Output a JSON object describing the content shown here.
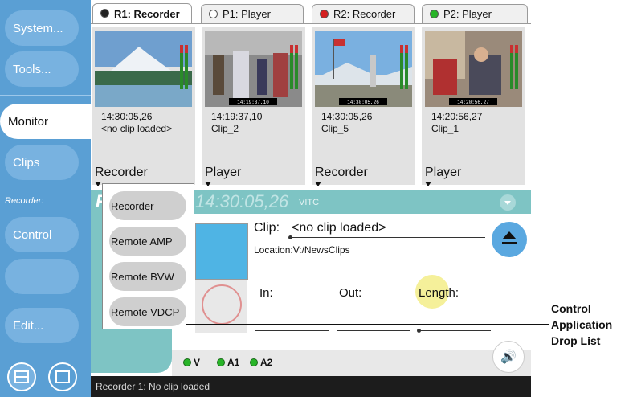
{
  "sidebar": {
    "items": [
      {
        "label": "System..."
      },
      {
        "label": "Tools..."
      },
      {
        "label": "Monitor"
      },
      {
        "label": "Clips"
      },
      {
        "label": "Control"
      },
      {
        "label": ""
      },
      {
        "label": "Edit..."
      }
    ],
    "section_label": "Recorder:",
    "layout_icons": [
      "split-view-icon",
      "single-view-icon"
    ]
  },
  "tabs": [
    {
      "label": "R1: Recorder",
      "led_color": "#222222",
      "active": true
    },
    {
      "label": "P1: Player",
      "led_color": "#ffffff",
      "active": false
    },
    {
      "label": "R2: Recorder",
      "led_color": "#d42020",
      "active": false
    },
    {
      "label": "P2: Player",
      "led_color": "#28b428",
      "active": false
    }
  ],
  "channels": [
    {
      "timecode": "14:30:05,26",
      "clip": "<no clip loaded>",
      "mode": "Recorder",
      "thumb_timecode": ""
    },
    {
      "timecode": "14:19:37,10",
      "clip": "Clip_2",
      "mode": "Player",
      "thumb_timecode": "14:19:37,10"
    },
    {
      "timecode": "14:30:05,26",
      "clip": "Clip_5",
      "mode": "Recorder",
      "thumb_timecode": "14:30:05,26"
    },
    {
      "timecode": "14:20:56,27",
      "clip": "Clip_1",
      "mode": "Player",
      "thumb_timecode": "14:20:56,27"
    }
  ],
  "panel": {
    "timecode": "14:30:05,26",
    "timecode_prefix": "R",
    "timecode_label": "VITC",
    "clip_label": "Clip:",
    "clip_value": "<no clip loaded>",
    "location": "Location:V:/NewsClips",
    "in_label": "In:",
    "out_label": "Out:",
    "length_label": "Length:",
    "indicators": [
      {
        "label": "V"
      },
      {
        "label": "A1"
      },
      {
        "label": "A2"
      }
    ]
  },
  "droplist": {
    "items": [
      "Recorder",
      "Remote AMP",
      "Remote BVW",
      "Remote VDCP"
    ]
  },
  "status": {
    "text": "Recorder 1: No clip loaded"
  },
  "callout": {
    "line1": "Control",
    "line2": "Application",
    "line3": "Drop List"
  },
  "colors": {
    "sidebar": "#5a9fd4",
    "panel_accent": "#7ec4c4",
    "eject": "#5aa8e0",
    "highlight": "#f5f09a"
  }
}
